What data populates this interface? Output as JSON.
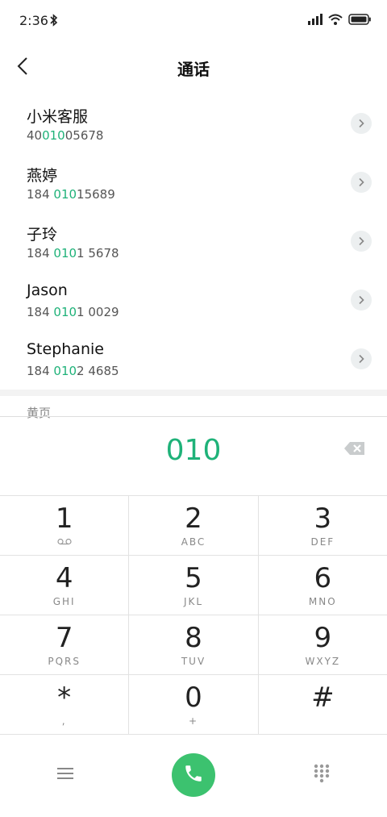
{
  "status_bar": {
    "time": "2:36"
  },
  "header": {
    "title": "通话"
  },
  "contacts": [
    {
      "name": "小米客服",
      "number_pre": "40",
      "number_hl": "010",
      "number_post": "05678"
    },
    {
      "name": "燕婷",
      "number_pre": "184 ",
      "number_hl": "010",
      "number_post": "15689"
    },
    {
      "name": "子玲",
      "number_pre": "184 ",
      "number_hl": "010",
      "number_post": "1 5678"
    },
    {
      "name": "Jason",
      "number_pre": "184 ",
      "number_hl": "010",
      "number_post": "1 0029"
    },
    {
      "name": "Stephanie",
      "number_pre": "184 ",
      "number_hl": "010",
      "number_post": "2 4685"
    }
  ],
  "yellow_pages": "黄页",
  "dial_input": "010",
  "keypad": [
    {
      "digit": "1",
      "letters": "",
      "icon": "voicemail-icon"
    },
    {
      "digit": "2",
      "letters": "ABC"
    },
    {
      "digit": "3",
      "letters": "DEF"
    },
    {
      "digit": "4",
      "letters": "GHI"
    },
    {
      "digit": "5",
      "letters": "JKL"
    },
    {
      "digit": "6",
      "letters": "MNO"
    },
    {
      "digit": "7",
      "letters": "PQRS"
    },
    {
      "digit": "8",
      "letters": "TUV"
    },
    {
      "digit": "9",
      "letters": "WXYZ"
    },
    {
      "digit": "*",
      "letters": ","
    },
    {
      "digit": "0",
      "letters": "+"
    },
    {
      "digit": "#",
      "letters": ""
    }
  ],
  "colors": {
    "accent": "#1fb279",
    "call_button": "#3cc26f"
  },
  "icons": {
    "back": "back-arrow-icon",
    "detail": "chevron-right-icon",
    "backspace": "backspace-icon",
    "menu": "menu-icon",
    "call": "phone-icon",
    "dialpad": "dialpad-icon"
  }
}
